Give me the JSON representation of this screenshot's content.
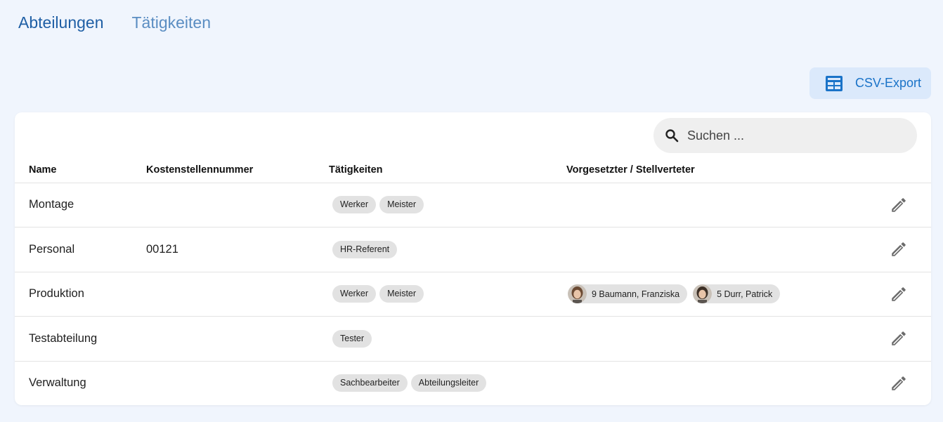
{
  "tabs": [
    {
      "label": "Abteilungen",
      "active": true
    },
    {
      "label": "Tätigkeiten",
      "active": false
    }
  ],
  "toolbar": {
    "csv_export_label": "CSV-Export",
    "csv_export_icon": "table-icon"
  },
  "search": {
    "placeholder": "Suchen ...",
    "value": "",
    "icon": "search-icon"
  },
  "table": {
    "columns": [
      "Name",
      "Kostenstellennummer",
      "Tätigkeiten",
      "Vorgesetzter / Stellverteter"
    ],
    "rows": [
      {
        "name": "Montage",
        "kostenstelle": "",
        "taetigkeiten": [
          "Werker",
          "Meister"
        ],
        "vorgesetzte": []
      },
      {
        "name": "Personal",
        "kostenstelle": "00121",
        "taetigkeiten": [
          "HR-Referent"
        ],
        "vorgesetzte": []
      },
      {
        "name": "Produktion",
        "kostenstelle": "",
        "taetigkeiten": [
          "Werker",
          "Meister"
        ],
        "vorgesetzte": [
          "9 Baumann, Franziska",
          "5 Durr, Patrick"
        ]
      },
      {
        "name": "Testabteilung",
        "kostenstelle": "",
        "taetigkeiten": [
          "Tester"
        ],
        "vorgesetzte": []
      },
      {
        "name": "Verwaltung",
        "kostenstelle": "",
        "taetigkeiten": [
          "Sachbearbeiter",
          "Abteilungsleiter"
        ],
        "vorgesetzte": []
      }
    ],
    "row_action_icon": "edit-pencil-icon"
  },
  "colors": {
    "background": "#f0f5fd",
    "accent": "#1a73c8",
    "tab_active": "#1f5fa5",
    "tab_inactive": "#5a8dc2",
    "chip": "#e2e2e2"
  }
}
